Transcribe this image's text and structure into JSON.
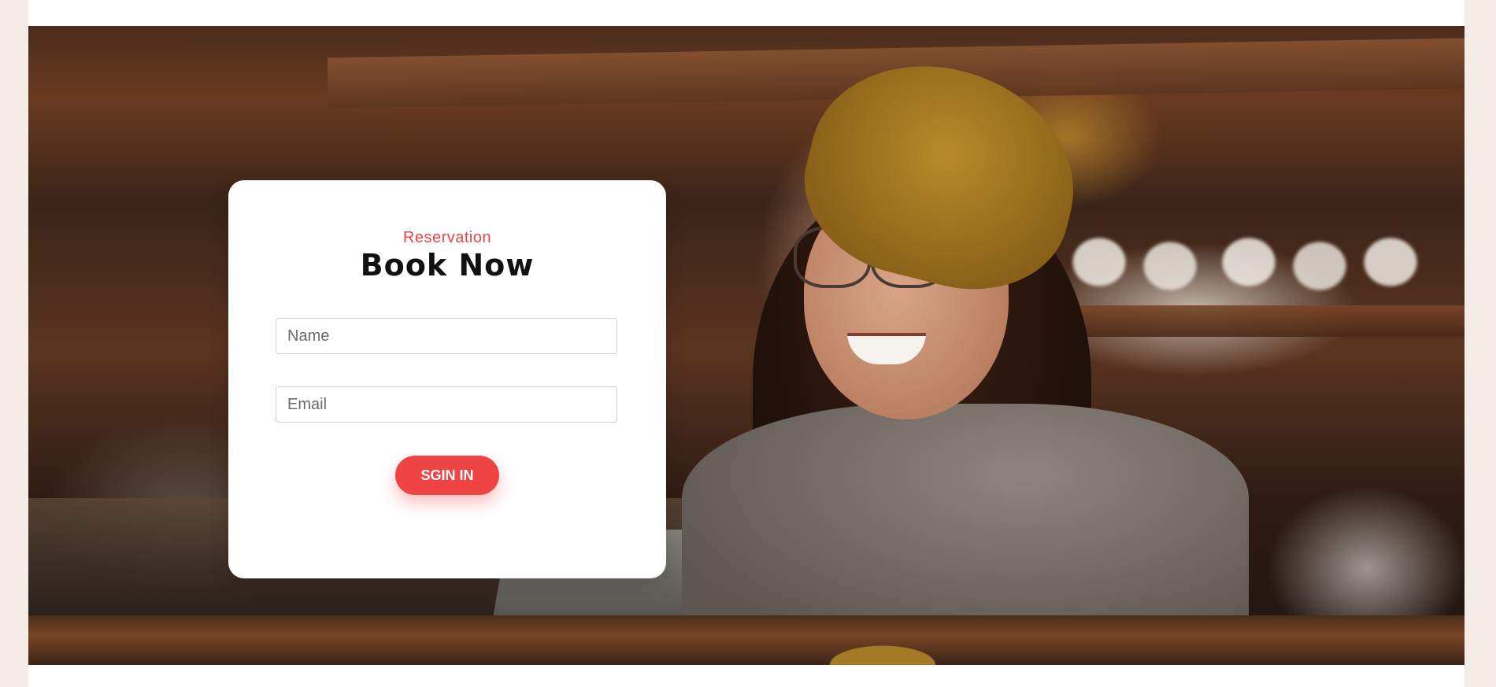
{
  "reservation": {
    "eyebrow": "Reservation",
    "title": "Book Now",
    "name_placeholder": "Name",
    "email_placeholder": "Email",
    "submit_label": "SGIN IN"
  },
  "colors": {
    "accent": "#ef4444",
    "page_background": "#f4ede7",
    "card_background": "#ffffff"
  }
}
